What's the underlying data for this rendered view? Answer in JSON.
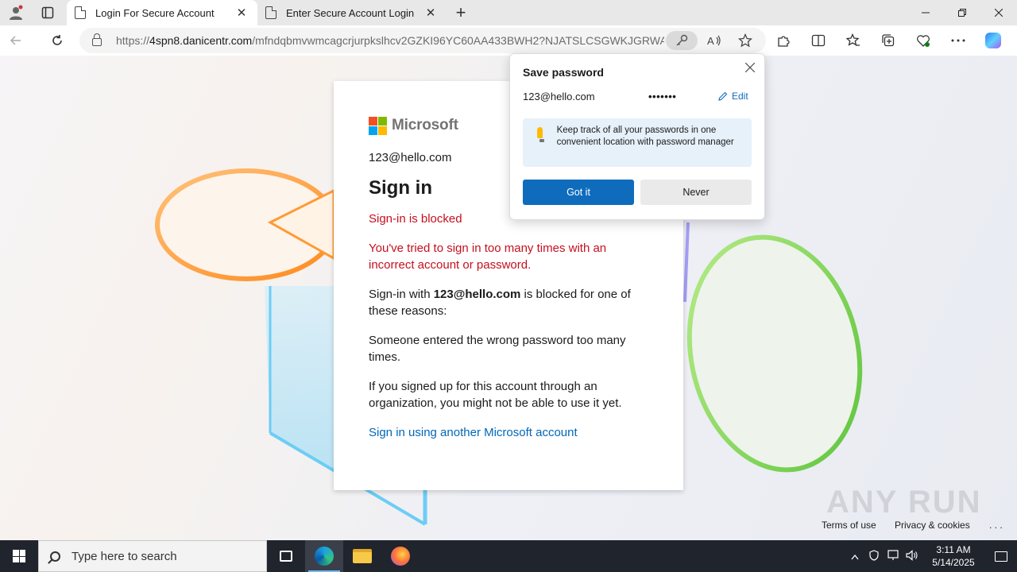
{
  "browser": {
    "tabs": [
      {
        "title": "Login For Secure Account",
        "active": true
      },
      {
        "title": "Enter Secure Account Login",
        "active": false
      }
    ],
    "close_glyph": "✕",
    "new_tab_glyph": "+",
    "url_scheme": "https://",
    "url_host": "4spn8.danicentr.com",
    "url_path": "/mfndqbmvwmcagcrjurpkslhcv2GZKI96YC60AA433BWH2?NJATSLCSGWKJGRWAX..."
  },
  "page": {
    "brand": "Microsoft",
    "identity": "123@hello.com",
    "heading": "Sign in",
    "blocked_title": "Sign-in is blocked",
    "blocked_body": "You've tried to sign in too many times with an incorrect account or password.",
    "para1_prefix": "Sign-in with ",
    "para1_email": "123@hello.com",
    "para1_suffix": " is blocked for one of these reasons:",
    "para2": "Someone entered the wrong password too many times.",
    "para3": "If you signed up for this account through an organization, you might not be able to use it yet.",
    "link": "Sign in using another Microsoft account",
    "footer_terms": "Terms of use",
    "footer_privacy": "Privacy & cookies",
    "footer_more": ". . .",
    "watermark": "ANY RUN"
  },
  "popup": {
    "title": "Save password",
    "username": "123@hello.com",
    "password_mask": "•••••••",
    "edit_label": "Edit",
    "tip": "Keep track of all your passwords in one convenient location with password manager",
    "primary_button": "Got it",
    "secondary_button": "Never",
    "colors": {
      "primary": "#0f6cbd",
      "tip_bg": "#e6f1fa"
    }
  },
  "taskbar": {
    "search_placeholder": "Type here to search",
    "time": "3:11 AM",
    "date": "5/14/2025"
  },
  "colors": {
    "error": "#c50f1f",
    "link": "#0067b8"
  }
}
